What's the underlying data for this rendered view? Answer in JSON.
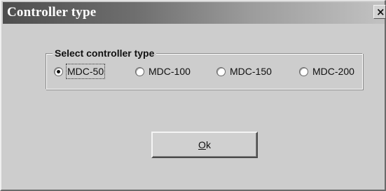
{
  "window": {
    "title": "Controller type",
    "close_icon": "close-x-icon",
    "close_glyph": "×"
  },
  "group": {
    "legend": "Select controller type",
    "options": [
      {
        "label": "MDC-50",
        "selected": true
      },
      {
        "label": "MDC-100",
        "selected": false
      },
      {
        "label": "MDC-150",
        "selected": false
      },
      {
        "label": "MDC-200",
        "selected": false
      }
    ]
  },
  "ok_button": {
    "mnemonic": "O",
    "rest": "k"
  }
}
